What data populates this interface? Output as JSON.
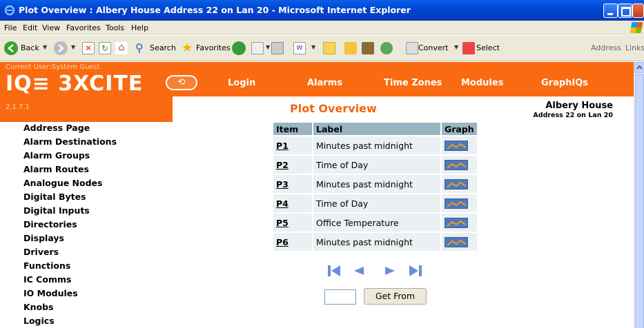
{
  "window": {
    "title": "Plot Overview : Albery House Address 22 on Lan 20 - Microsoft Internet Explorer"
  },
  "menu": [
    "File",
    "Edit",
    "View",
    "Favorites",
    "Tools",
    "Help"
  ],
  "toolbar": {
    "back": "Back",
    "search": "Search",
    "favorites": "Favorites",
    "convert": "Convert",
    "select": "Select",
    "address": "Address",
    "links": "Links"
  },
  "header": {
    "current_user": "Current User:System Guest",
    "logo": "IQ≡ 3XCITE",
    "version": "2.1.7.1",
    "nav": [
      "Login",
      "Alarms",
      "Time Zones",
      "Modules",
      "GraphIQs"
    ],
    "page_title": "Plot Overview",
    "site_name": "Albery House",
    "site_address": "Address 22 on Lan 20"
  },
  "sidebar": [
    "Address Page",
    "Alarm Destinations",
    "Alarm Groups",
    "Alarm Routes",
    "Analogue Nodes",
    "Digital Bytes",
    "Digital Inputs",
    "Directories",
    "Displays",
    "Drivers",
    "Functions",
    "IC Comms",
    "IO Modules",
    "Knobs",
    "Logics"
  ],
  "table": {
    "headers": [
      "Item",
      "Label",
      "Graph"
    ],
    "rows": [
      {
        "item": "P1",
        "label": "Minutes past midnight"
      },
      {
        "item": "P2",
        "label": "Time of Day"
      },
      {
        "item": "P3",
        "label": "Minutes past midnight"
      },
      {
        "item": "P4",
        "label": "Time of Day"
      },
      {
        "item": "P5",
        "label": "Office Temperature"
      },
      {
        "item": "P6",
        "label": "Minutes past midnight"
      }
    ]
  },
  "get_from": {
    "button": "Get From",
    "value": ""
  },
  "colors": {
    "header_orange": "#fa6a10",
    "title_orange": "#f06510",
    "table_header": "#9ab5c2",
    "table_cell": "#ebf0f2",
    "pager_blue": "#6a8fd8"
  }
}
